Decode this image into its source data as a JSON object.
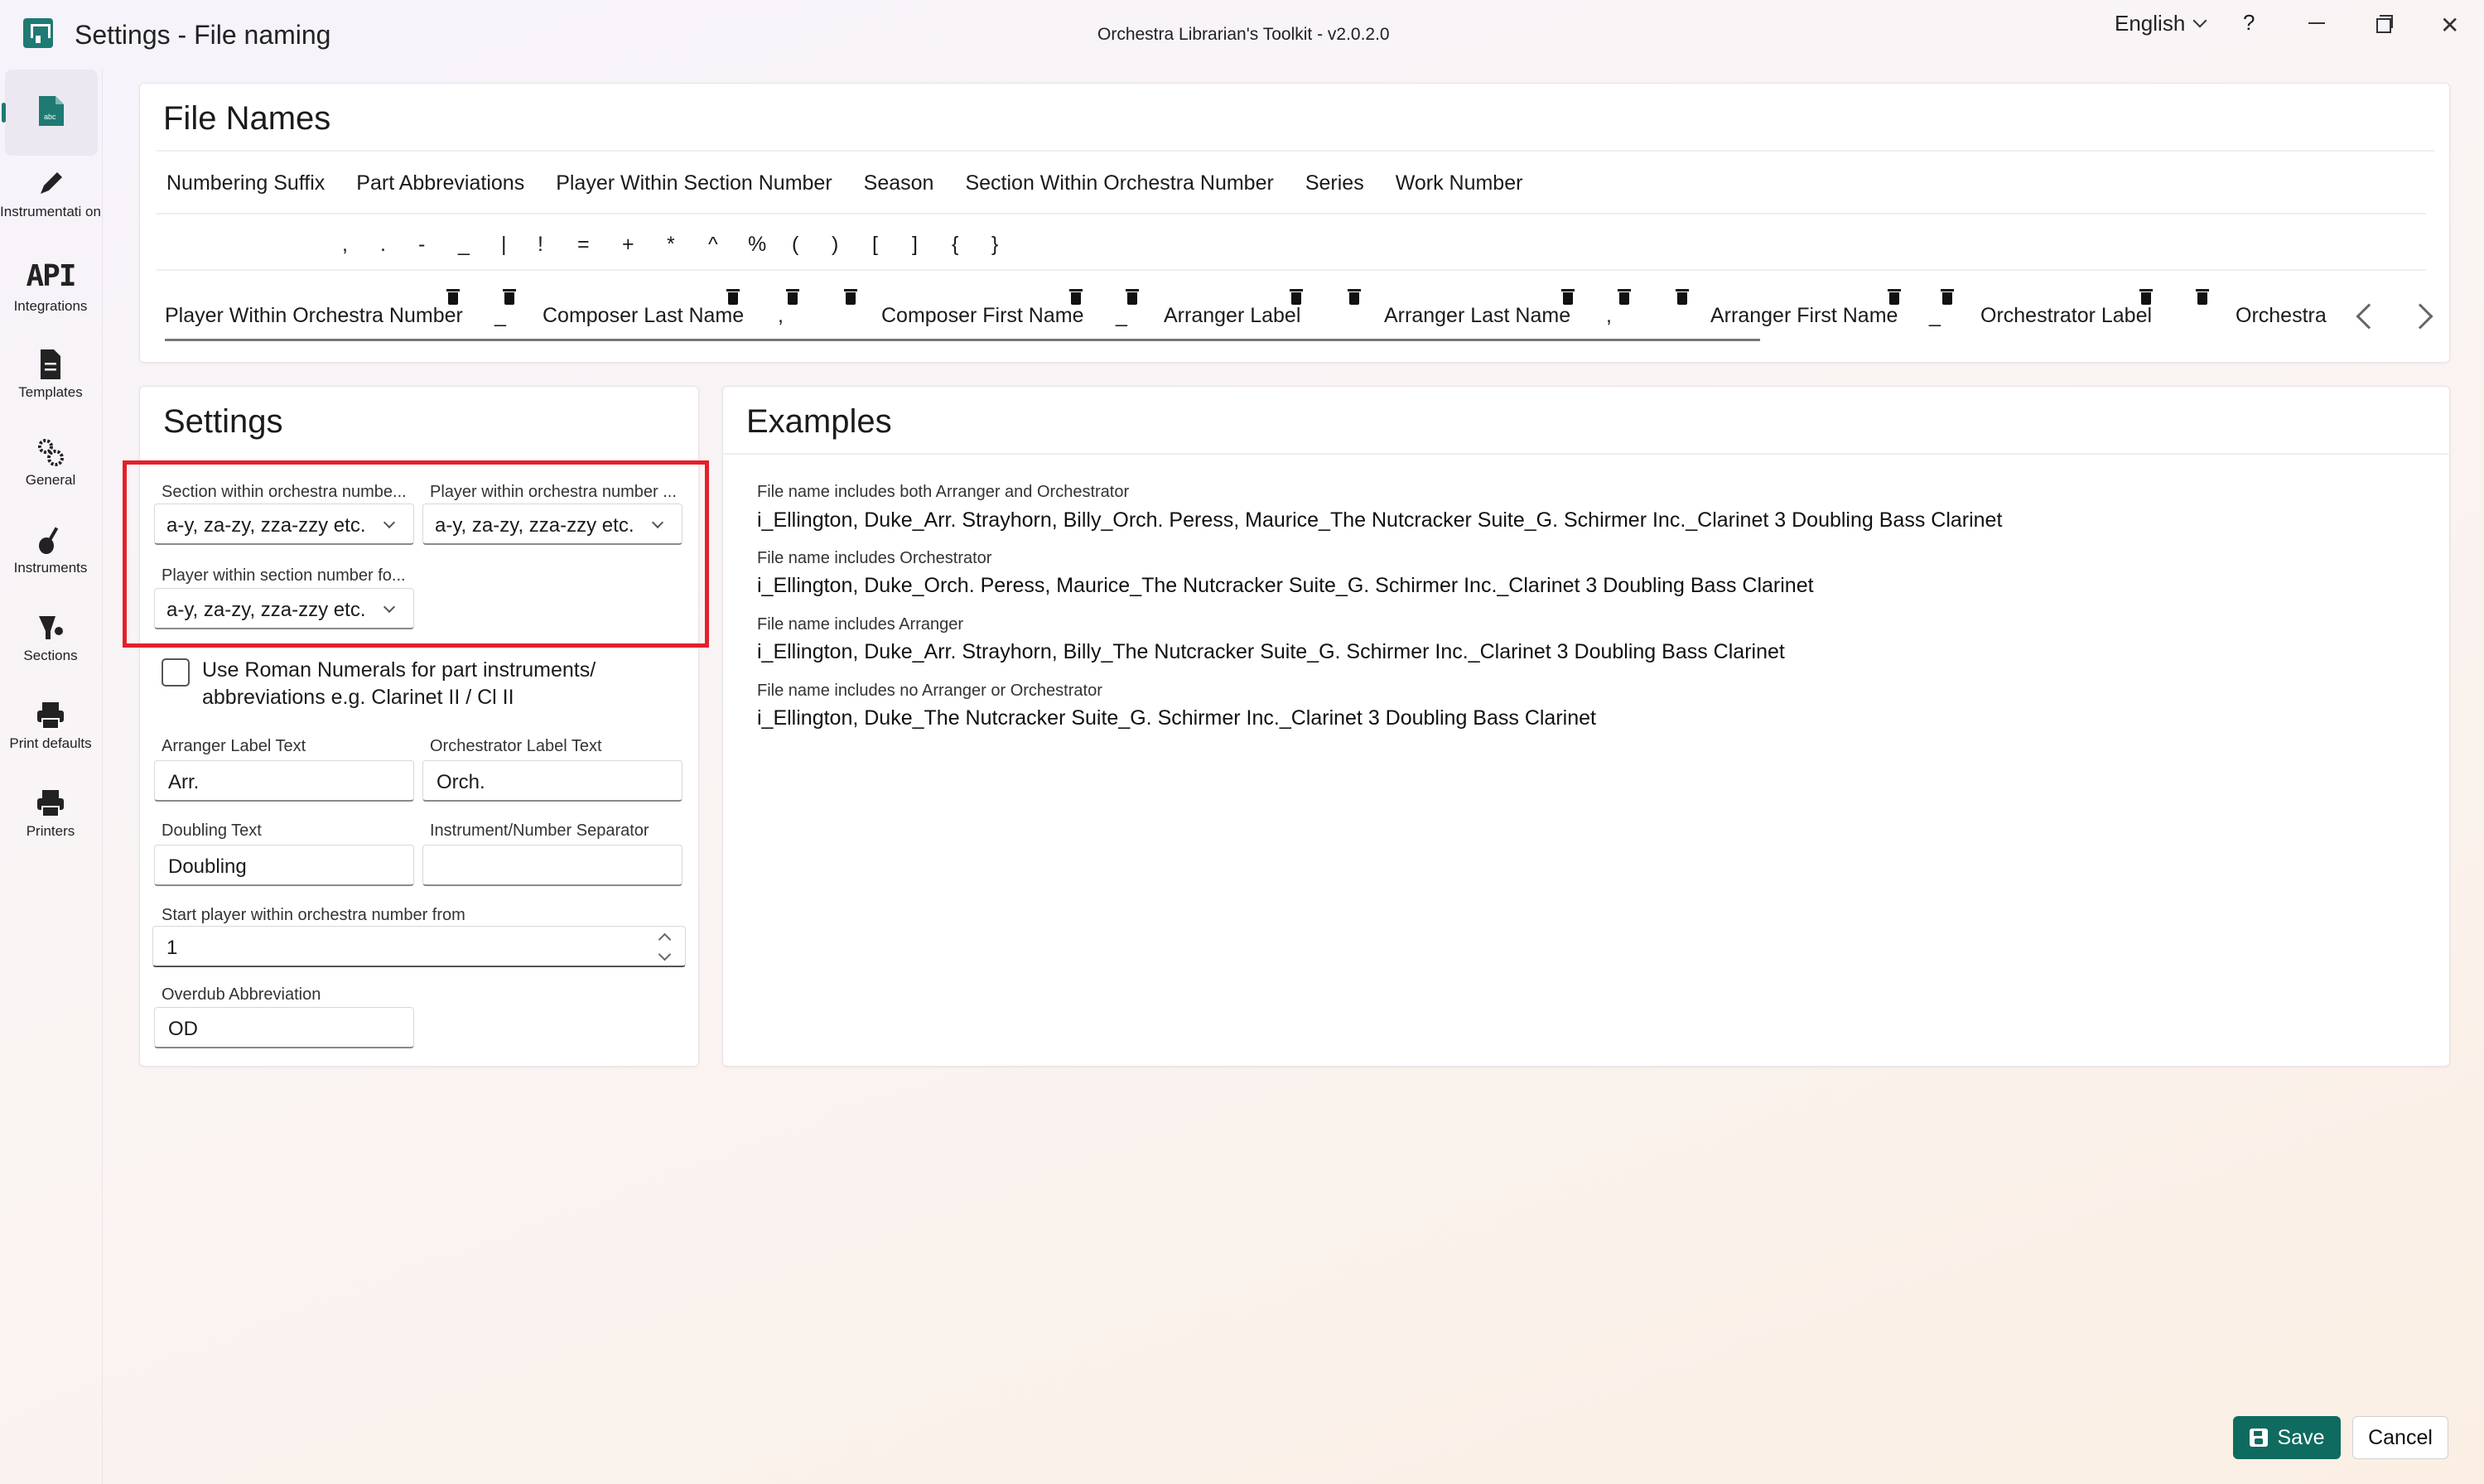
{
  "window": {
    "title": "Settings - File naming",
    "app_title": "Orchestra Librarian's Toolkit - v2.0.2.0",
    "language": "English",
    "help": "?",
    "close": "✕"
  },
  "sidebar": {
    "items": [
      {
        "label": "",
        "icon": "file-abc-icon",
        "active": true
      },
      {
        "label": "Instrumentati on",
        "icon": "pen-icon"
      },
      {
        "label": "Integrations",
        "icon": "api-icon",
        "icon_text": "API"
      },
      {
        "label": "Templates",
        "icon": "document-icon"
      },
      {
        "label": "General",
        "icon": "gears-icon"
      },
      {
        "label": "Instruments",
        "icon": "violin-icon"
      },
      {
        "label": "Sections",
        "icon": "timpani-icon"
      },
      {
        "label": "Print defaults",
        "icon": "printer-icon"
      },
      {
        "label": "Printers",
        "icon": "printer-icon"
      }
    ]
  },
  "file_names": {
    "title": "File Names",
    "tabs": [
      "Numbering Suffix",
      "Part Abbreviations",
      "Player Within Section Number",
      "Season",
      "Section Within Orchestra Number",
      "Series",
      "Work Number"
    ],
    "symbols": [
      ",",
      ".",
      "-",
      "_",
      "|",
      "!",
      "=",
      "+",
      "*",
      "^",
      "%",
      "(",
      ")",
      "[",
      "]",
      "{",
      "}"
    ],
    "segments": [
      "Player Within Orchestra Number",
      "_",
      "Composer Last Name",
      ",",
      "Composer First Name",
      "_",
      "Arranger Label",
      "Arranger Last Name",
      ",",
      "Arranger First Name",
      "_",
      "Orchestrator Label",
      "Orchestra"
    ]
  },
  "settings": {
    "title": "Settings",
    "section_within_label": "Section within orchestra numbe...",
    "section_within_value": "a-y, za-zy, zza-zzy etc.",
    "player_within_orch_label": "Player within orchestra number ...",
    "player_within_orch_value": "a-y, za-zy, zza-zzy etc.",
    "player_within_section_label": "Player within section number fo...",
    "player_within_section_value": "a-y, za-zy, zza-zzy etc.",
    "roman_numerals_label": "Use Roman Numerals for part instruments/ abbreviations e.g. Clarinet II / Cl II",
    "roman_numerals_checked": false,
    "arranger_label_title": "Arranger Label Text",
    "arranger_label_value": "Arr.",
    "orchestrator_label_title": "Orchestrator Label Text",
    "orchestrator_label_value": "Orch.",
    "doubling_title": "Doubling Text",
    "doubling_value": "Doubling",
    "separator_title": "Instrument/Number Separator",
    "separator_value": "",
    "start_player_title": "Start player within orchestra number from",
    "start_player_value": "1",
    "overdub_title": "Overdub Abbreviation",
    "overdub_value": "OD"
  },
  "examples": {
    "title": "Examples",
    "items": [
      {
        "label": "File name includes both Arranger and Orchestrator",
        "value": "i_Ellington, Duke_Arr. Strayhorn, Billy_Orch. Peress, Maurice_The Nutcracker Suite_G. Schirmer Inc._Clarinet 3 Doubling Bass Clarinet"
      },
      {
        "label": "File name includes Orchestrator",
        "value": "i_Ellington, Duke_Orch. Peress, Maurice_The Nutcracker Suite_G. Schirmer Inc._Clarinet 3 Doubling Bass Clarinet"
      },
      {
        "label": "File name includes Arranger",
        "value": "i_Ellington, Duke_Arr. Strayhorn, Billy_The Nutcracker Suite_G. Schirmer Inc._Clarinet 3 Doubling Bass Clarinet"
      },
      {
        "label": "File name includes no Arranger or Orchestrator",
        "value": "i_Ellington, Duke_The Nutcracker Suite_G. Schirmer Inc._Clarinet 3 Doubling Bass Clarinet"
      }
    ]
  },
  "footer": {
    "save_label": "Save",
    "cancel_label": "Cancel"
  },
  "colors": {
    "accent": "#0f6b5f",
    "highlight": "#e3202a"
  }
}
